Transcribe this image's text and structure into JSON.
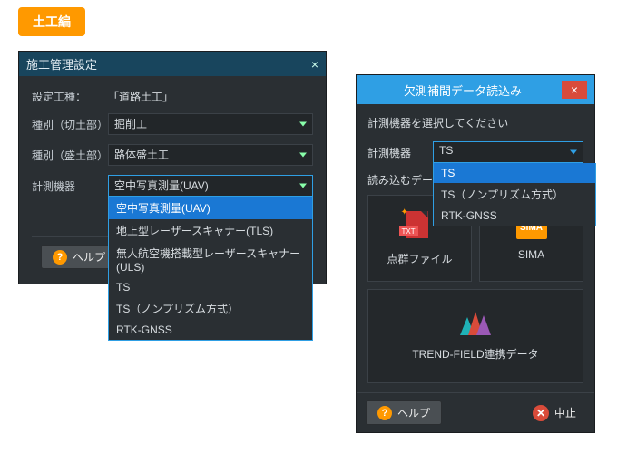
{
  "badge": "土工編",
  "left": {
    "title": "施工管理設定",
    "close": "×",
    "set_type_label": "設定工種：",
    "set_type_value": "「道路土工」",
    "row1_label": "種別（切土部）",
    "row1_value": "掘削工",
    "row2_label": "種別（盛土部）",
    "row2_value": "路体盛土工",
    "row3_label": "計測機器",
    "row3_value": "空中写真測量(UAV)",
    "options": [
      "空中写真測量(UAV)",
      "地上型レーザースキャナー(TLS)",
      "無人航空機搭載型レーザースキャナー(ULS)",
      "TS",
      "TS（ノンプリズム方式）",
      "RTK-GNSS"
    ],
    "help": "ヘルプ"
  },
  "right": {
    "title": "欠測補間データ読込み",
    "close": "×",
    "prompt": "計測機器を選択してください",
    "device_label": "計測機器",
    "device_value": "TS",
    "options": [
      "TS",
      "TS（ノンプリズム方式）",
      "RTK-GNSS"
    ],
    "line2": "読み込むデータを選",
    "tile1": "点群ファイル",
    "tile1_icon": "TXT",
    "tile2": "SIMA",
    "tile2_icon": "SIMA",
    "tile3": "TREND-FIELD連携データ",
    "help": "ヘルプ",
    "cancel": "中止"
  }
}
